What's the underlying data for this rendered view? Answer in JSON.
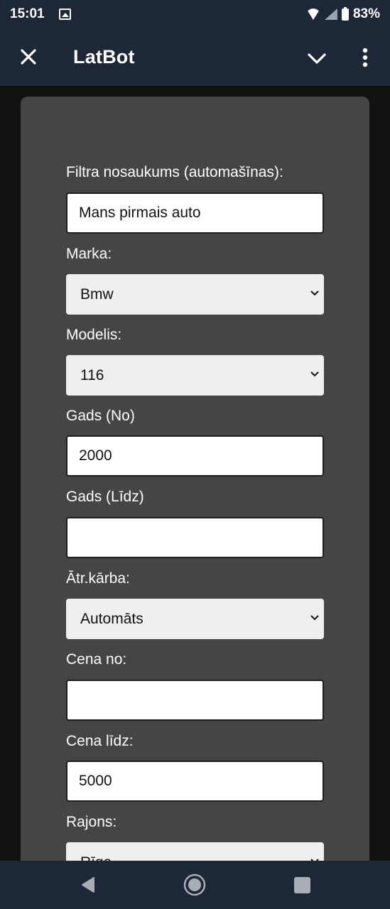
{
  "status_bar": {
    "time": "15:01",
    "battery": "83%",
    "icons": [
      "gallery-icon",
      "wifi-icon",
      "signal-icon",
      "battery-icon"
    ]
  },
  "app_bar": {
    "title": "LatBot",
    "icons": [
      "close-icon",
      "chevron-down-icon",
      "more-vert-icon"
    ]
  },
  "form": {
    "filter_name": {
      "label": "Filtra nosaukums (automašīnas):",
      "value": "Mans pirmais auto"
    },
    "brand": {
      "label": "Marka:",
      "selected": "Bmw"
    },
    "model": {
      "label": "Modelis:",
      "selected": "116"
    },
    "year_from": {
      "label": "Gads (No)",
      "value": "2000"
    },
    "year_to": {
      "label": "Gads (Līdz)",
      "value": ""
    },
    "gearbox": {
      "label": "Ātr.kārba:",
      "selected": "Automāts"
    },
    "price_from": {
      "label": "Cena no:",
      "value": ""
    },
    "price_to": {
      "label": "Cena līdz:",
      "value": "5000"
    },
    "region": {
      "label": "Rajons:",
      "selected": "Rīga"
    }
  },
  "nav_bar": {
    "icons": [
      "back-icon",
      "home-icon",
      "recents-icon"
    ]
  },
  "colors": {
    "system_bars": "#1e2738",
    "background": "#0f120f",
    "card": "#454545",
    "select_bg": "#efefef",
    "input_bg": "#ffffff"
  }
}
